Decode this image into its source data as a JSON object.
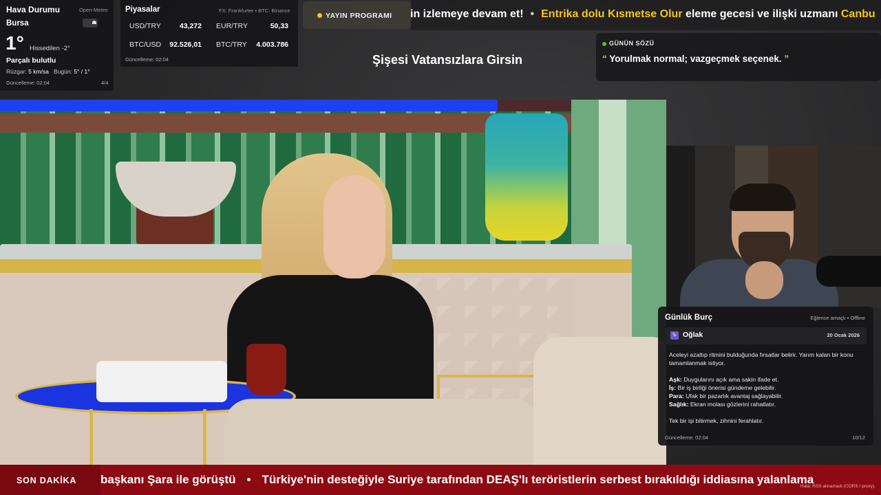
{
  "weather": {
    "title": "Hava Durumu",
    "source": "Open-Meteo",
    "city": "Bursa",
    "temp": "1°",
    "feels_like": "Hissedilen -2°",
    "condition": "Parçalı bulutlu",
    "wind_label": "Rüzgar:",
    "wind_value": "5 km/sa",
    "today_label": "Bugün:",
    "today_value": "5° / 1°",
    "updated": "Güncelleme: 02:04",
    "page": "4/4",
    "icon": "partly-cloudy-icon"
  },
  "markets": {
    "title": "Piyasalar",
    "source": "FX: Frankfurter • BTC: Binance",
    "rows": [
      {
        "name": "USD/TRY",
        "value": "43,272"
      },
      {
        "name": "EUR/TRY",
        "value": "50,33"
      },
      {
        "name": "BTC/USD",
        "value": "92.526,01"
      },
      {
        "name": "BTC/TRY",
        "value": "4.003.786"
      }
    ],
    "updated": "Güncelleme: 02:04"
  },
  "schedule": {
    "label": "YAYIN PROGRAMI",
    "accent": "#f5c518"
  },
  "top_ticker": {
    "part1": "in izlemeye devam et!",
    "sep": "•",
    "part2_highlight": "Entrika dolu Kısmetse Olur",
    "part2_rest": " eleme gecesi ve ilişki uzmanı ",
    "part3_highlight": "Canbu"
  },
  "title": "Şişesi Vatansızlara Girsin",
  "quote": {
    "label": "GÜNÜN SÖZÜ",
    "open": "“",
    "text": " Yorulmak normal; vazgeçmek seçenek. ",
    "close": "”"
  },
  "horoscope": {
    "title": "Günlük Burç",
    "status": "Eğlence amaçlı • Offline",
    "sign_icon": "♑",
    "sign": "Oğlak",
    "date": "20 Ocak 2026",
    "intro": "Aceleyi azaltıp ritmini bulduğunda fırsatlar belirir. Yarım kalan bir konu tamamlanmak istiyor.",
    "love_label": "Aşk:",
    "love": " Duygularını açık ama sakin ifade et.",
    "work_label": "İş:",
    "work": " Bir iş birliği önerisi gündeme gelebilir.",
    "money_label": "Para:",
    "money": " Ufak bir pazarlık avantaj sağlayabilir.",
    "health_label": "Sağlık:",
    "health": " Ekran molası gözlerini rahatlatır.",
    "tip": "Tek bir işi bitirmek, zihnini ferahlatır.",
    "updated": "Güncelleme: 02:04",
    "page": "10/12"
  },
  "breaking": {
    "label": "SON DAKİKA",
    "text1": "başkanı Şara ile görüştü",
    "sep": "•",
    "text2": "Türkiye'nin desteğiyle Suriye tarafından DEAŞ'lı teröristlerin serbest bırakıldığı iddiasına yalanlama",
    "error": "Hata: RSS alınamadı (CORS / proxy)."
  },
  "colors": {
    "accent_yellow": "#f5c518",
    "breaking_red": "#8e0a12",
    "quote_dot": "#52c41a"
  }
}
